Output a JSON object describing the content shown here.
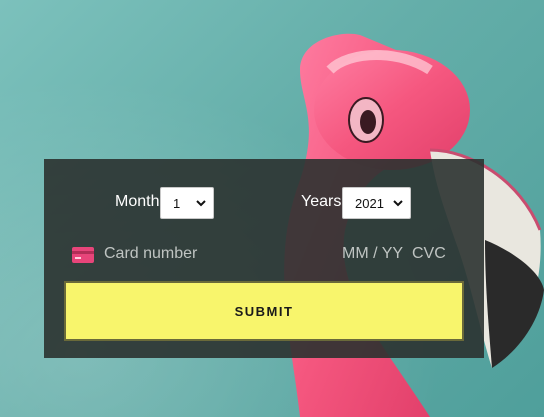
{
  "form": {
    "month_label": "Month",
    "month_value": "1",
    "years_label": "Years",
    "years_value": "2021",
    "card_placeholder": "Card number",
    "expiry_placeholder": "MM / YY",
    "cvc_placeholder": "CVC",
    "submit_label": "SUBMIT"
  },
  "icons": {
    "card": "credit-card-icon",
    "chevron": "chevron-down-icon"
  },
  "colors": {
    "accent_button": "#f8f56c",
    "card_icon": "#e8457a",
    "panel": "#2b3230"
  }
}
